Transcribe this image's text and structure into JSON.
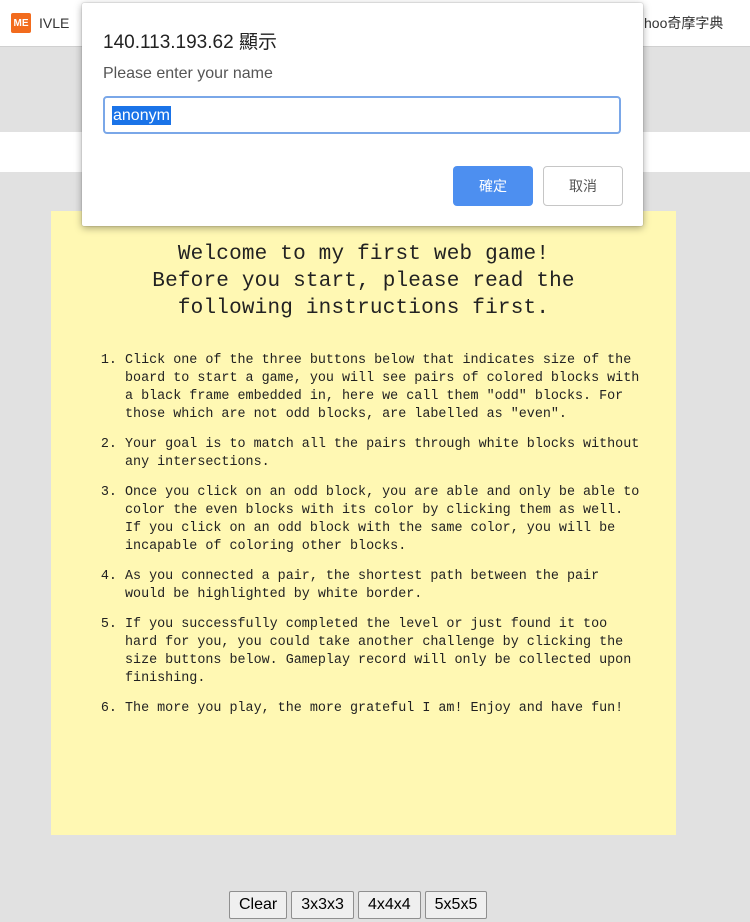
{
  "bookmarks": {
    "item1": {
      "icon": "ME",
      "label": "IVLE"
    },
    "item2": {
      "label": "hoo奇摩字典"
    }
  },
  "colors": {
    "page_bg": "#e1e1e1",
    "instructions_bg": "#fff8b3",
    "ok_button": "#4d8ff0",
    "selection": "#1a73e8"
  },
  "dialog": {
    "title": "140.113.193.62 顯示",
    "message": "Please enter your name",
    "input_value": "anonym",
    "ok_label": "確定",
    "cancel_label": "取消"
  },
  "instructions": {
    "heading_line1": "Welcome to my first web game!",
    "heading_line2": "Before you start, please read the",
    "heading_line3": "following instructions first.",
    "items": [
      "Click one of the three buttons below that indicates size of the board to start a game, you will see pairs of colored blocks with a black frame embedded in, here we call them \"odd\" blocks. For those which are not odd blocks, are labelled as \"even\".",
      "Your goal is to match all the pairs through white blocks without any intersections.",
      "Once you click on an odd block, you are able and only be able to color the even blocks with its color by clicking them as well. If you click on an odd block with the same color, you will be incapable of coloring other blocks.",
      "As you connected a pair, the shortest path between the pair would be highlighted by white border.",
      "If you successfully completed the level or just found it too hard for you, you could take another challenge by clicking the size buttons below. Gameplay record will only be collected upon finishing.",
      "The more you play, the more grateful I am! Enjoy and have fun!"
    ]
  },
  "controls": {
    "clear_label": "Clear",
    "size3_label": "3x3x3",
    "size4_label": "4x4x4",
    "size5_label": "5x5x5"
  }
}
